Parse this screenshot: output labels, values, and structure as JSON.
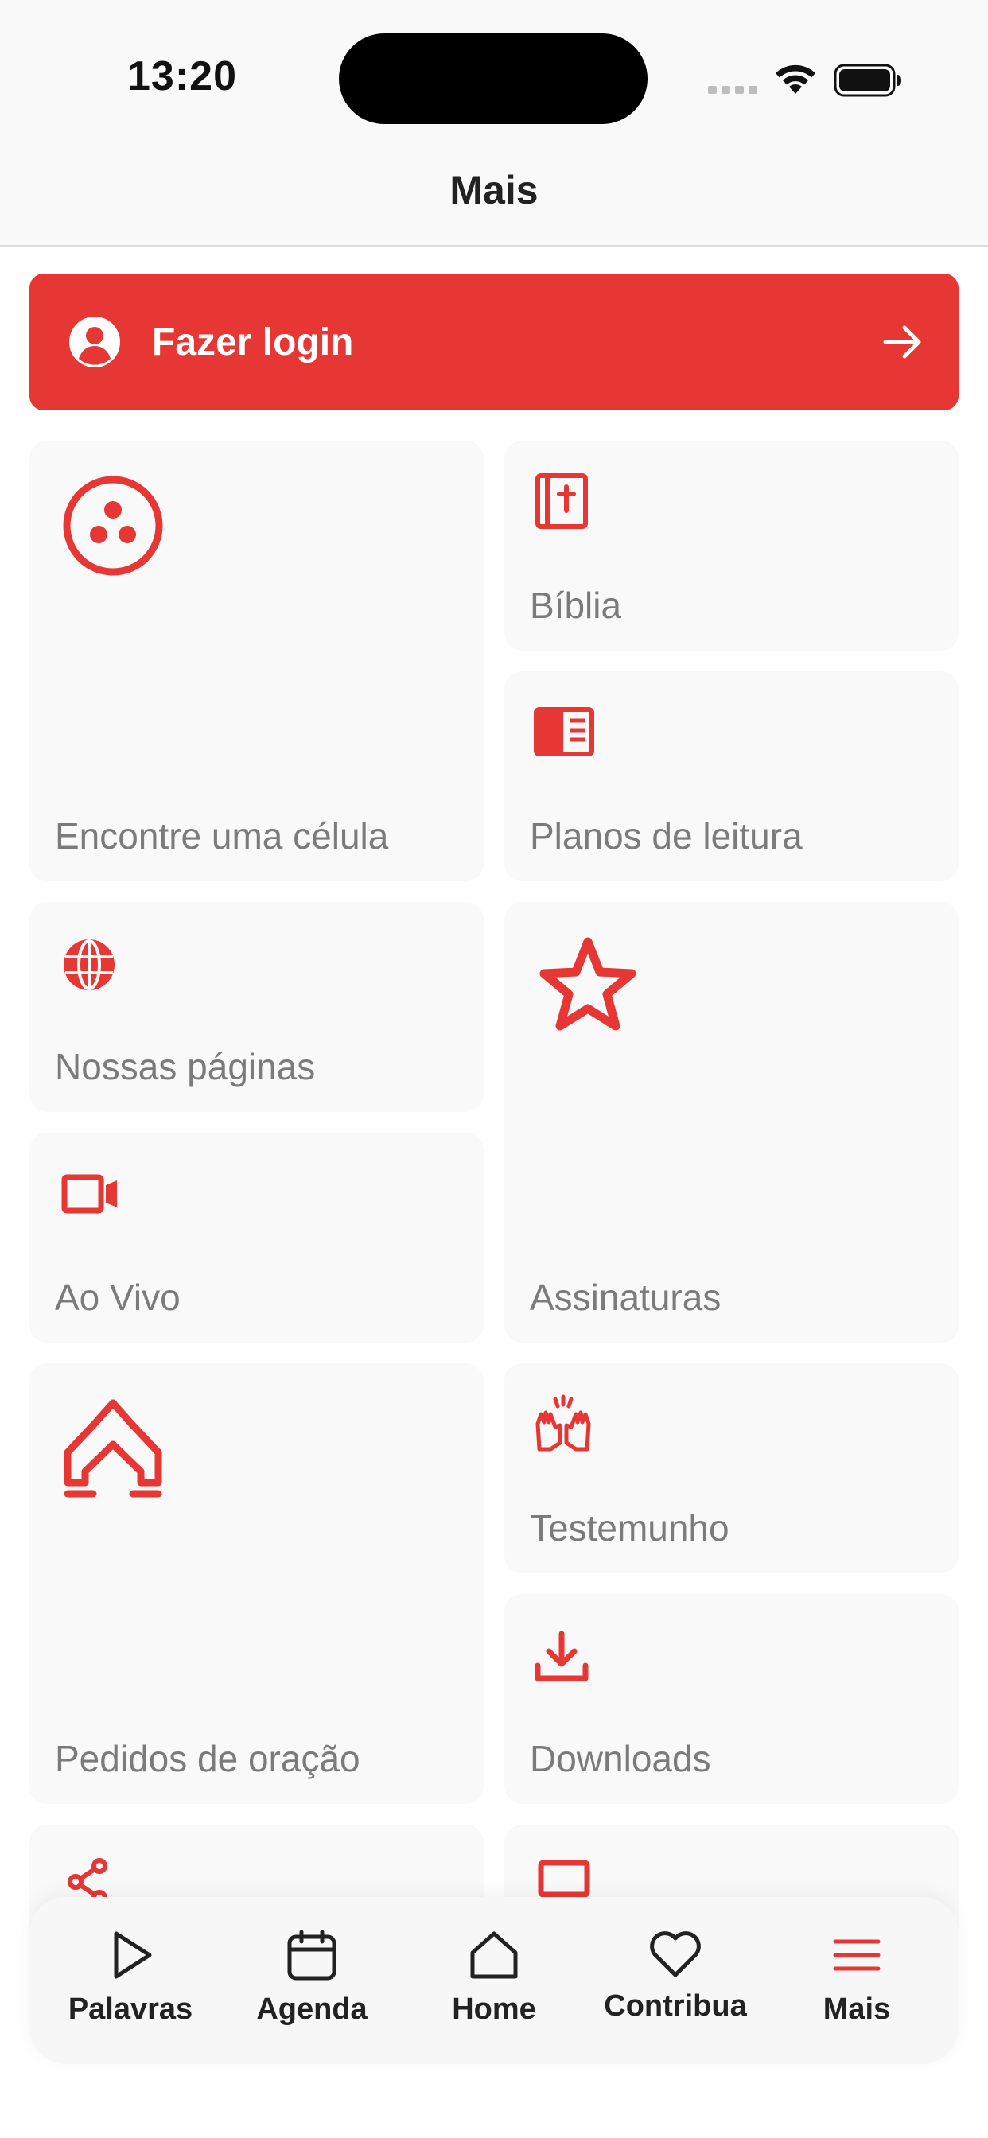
{
  "status_bar": {
    "time": "13:20"
  },
  "header": {
    "title": "Mais"
  },
  "login": {
    "label": "Fazer login"
  },
  "tiles": [
    {
      "label": "Encontre uma célula",
      "icon": "cell-group-icon"
    },
    {
      "label": "Bíblia",
      "icon": "bible-icon"
    },
    {
      "label": "Planos de leitura",
      "icon": "reading-plan-icon"
    },
    {
      "label": "Nossas páginas",
      "icon": "globe-icon"
    },
    {
      "label": "Assinaturas",
      "icon": "star-icon"
    },
    {
      "label": "Ao Vivo",
      "icon": "video-camera-icon"
    },
    {
      "label": "Pedidos de oração",
      "icon": "praying-hands-icon"
    },
    {
      "label": "Testemunho",
      "icon": "raised-hands-icon"
    },
    {
      "label": "Downloads",
      "icon": "download-icon"
    }
  ],
  "tab_bar": {
    "items": [
      {
        "label": "Palavras",
        "icon": "play-icon"
      },
      {
        "label": "Agenda",
        "icon": "calendar-icon"
      },
      {
        "label": "Home",
        "icon": "home-icon"
      },
      {
        "label": "Contribua",
        "icon": "heart-icon"
      },
      {
        "label": "Mais",
        "icon": "menu-icon"
      }
    ],
    "active": "Mais"
  },
  "colors": {
    "accent": "#e63734",
    "tile_bg": "#f9f9f9",
    "label": "#7b7b7b"
  }
}
